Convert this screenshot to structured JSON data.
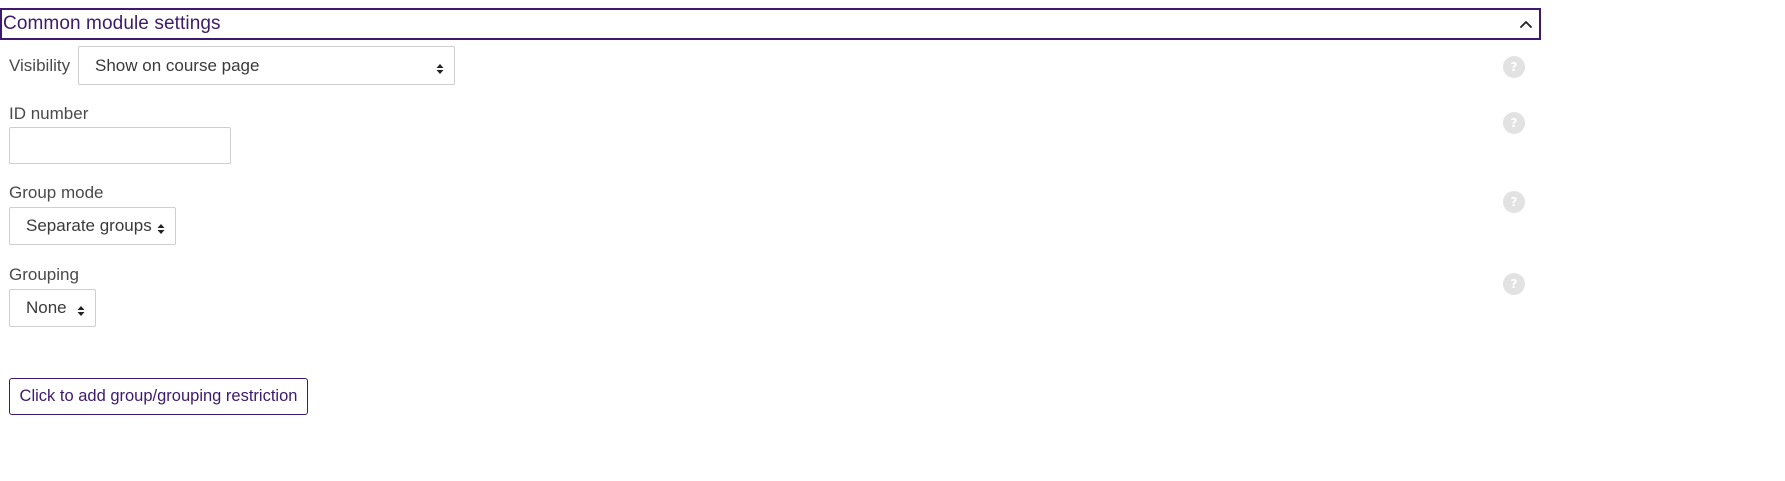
{
  "section": {
    "title": "Common module settings",
    "collapse_icon": "chevron-up-icon",
    "accent_color": "#3d1a6b"
  },
  "visibility": {
    "label": "Visibility",
    "selected": "Show on course page"
  },
  "id_number": {
    "label": "ID number",
    "value": ""
  },
  "group_mode": {
    "label": "Group mode",
    "selected": "Separate groups"
  },
  "grouping": {
    "label": "Grouping",
    "selected": "None"
  },
  "help": {
    "icon": "help-icon",
    "glyph": "?"
  },
  "restriction_button": {
    "label": "Click to add group/grouping restriction"
  }
}
